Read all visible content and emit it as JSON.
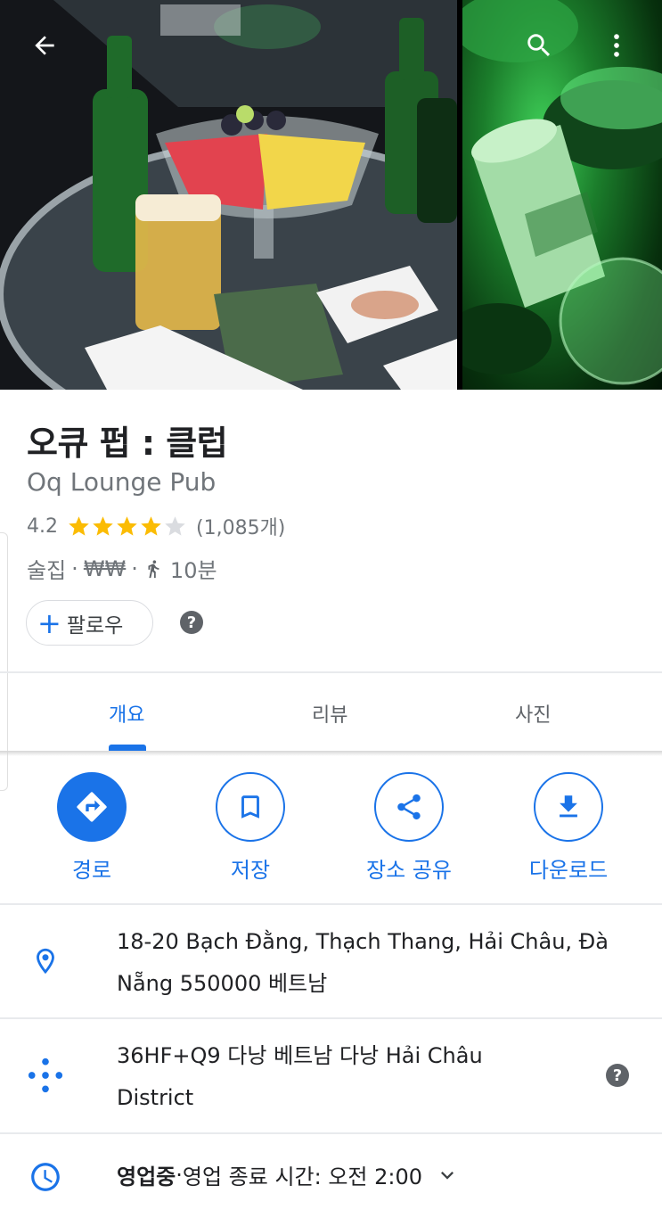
{
  "header": {
    "back_icon": "arrow-back-icon",
    "search_icon": "search-icon",
    "more_icon": "more-vert-icon"
  },
  "place": {
    "title": "오큐 펍 : 클럽",
    "subtitle": "Oq Lounge Pub",
    "rating": "4.2",
    "rating_value": 4.2,
    "rating_max": 5,
    "review_count": "(1,085개)",
    "category": "술집",
    "separator": "·",
    "price": "₩₩",
    "walk_time": "10분",
    "follow_label": "팔로우",
    "follow_plus": "+",
    "help_mark": "?"
  },
  "tabs": [
    {
      "label": "개요",
      "active": true
    },
    {
      "label": "리뷰",
      "active": false
    },
    {
      "label": "사진",
      "active": false
    }
  ],
  "actions": [
    {
      "label": "경로",
      "icon": "directions-icon"
    },
    {
      "label": "저장",
      "icon": "bookmark-icon"
    },
    {
      "label": "장소 공유",
      "icon": "share-icon"
    },
    {
      "label": "다운로드",
      "icon": "download-icon"
    }
  ],
  "info": {
    "address_line1": "18-20 Bạch Đằng, Thạch Thang, Hải Châu, Đà",
    "address_line2": "Nẵng 550000 베트남",
    "pluscode_line1": "36HF+Q9 다낭 베트남 다낭 Hải Châu",
    "pluscode_line2": "District",
    "hours_status": "영업중",
    "hours_separator": " · ",
    "hours_detail": "영업 종료 시간: 오전 2:00"
  },
  "colors": {
    "accent": "#1a73e8",
    "star": "#fbbc04",
    "star_empty": "#dadce0",
    "secondary_text": "#70757a"
  }
}
